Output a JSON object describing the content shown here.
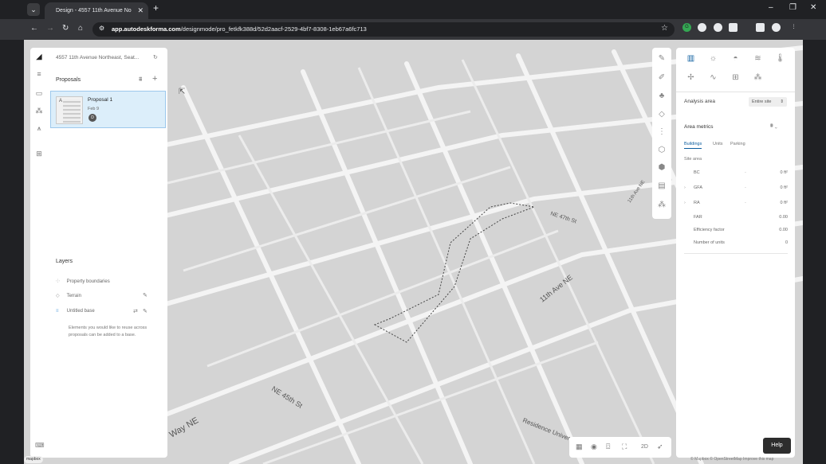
{
  "browser": {
    "tab_title": "Design - 4557 11th Avenue No",
    "tab_close": "✕",
    "new_tab": "+",
    "menu": "⌄",
    "controls": {
      "minimize": "–",
      "restore": "❐",
      "close": "✕"
    },
    "nav": {
      "back": "←",
      "forward": "→",
      "reload": "↻",
      "home": "⌂"
    },
    "url_host": "app.autodeskforma.com",
    "url_path": "/designmode/pro_fetkfk388d/52d2aacf-2529-4bf7-8308-1eb67a6fc713",
    "site_info_icon": "tune-icon",
    "bookmark_icon": "star-icon"
  },
  "left_panel": {
    "site_title": "4557 11th Avenue Northeast, Seat...",
    "proposals_label": "Proposals",
    "proposal": {
      "name": "Proposal 1",
      "date": "Feb 9",
      "avatar": "D",
      "thumb_letter": "A"
    },
    "layers_label": "Layers",
    "layers": [
      {
        "label": "Property boundaries",
        "icon": "boundary-icon"
      },
      {
        "label": "Terrain",
        "icon": "terrain-icon"
      },
      {
        "label": "Untitled base",
        "icon": "base-icon"
      }
    ],
    "base_note": "Elements you would like to reuse across proposals can be added to a base."
  },
  "right_panel": {
    "analysis_area_label": "Analysis area",
    "analysis_area_value": "Entire site",
    "area_metrics_label": "Area metrics",
    "tabs": [
      "Buildings",
      "Units",
      "Parking"
    ],
    "active_tab": "Buildings",
    "site_area_label": "Site area",
    "metrics": [
      {
        "label": "BC",
        "dash": "-",
        "value": "0 ft²",
        "expandable": false
      },
      {
        "label": "GFA",
        "dash": "-",
        "value": "0 ft²",
        "expandable": true
      },
      {
        "label": "RA",
        "dash": "-",
        "value": "0 ft²",
        "expandable": true
      },
      {
        "label": "FAR",
        "dash": "",
        "value": "0.00",
        "expandable": false
      },
      {
        "label": "Efficiency factor",
        "dash": "",
        "value": "0.00",
        "expandable": false
      },
      {
        "label": "Number of units",
        "dash": "",
        "value": "0",
        "expandable": false
      }
    ]
  },
  "map": {
    "street_labels": [
      "NE 45th St",
      "11th Ave NE",
      "NE 47th St",
      "11th Ave NE",
      "Way NE",
      "Residence University D"
    ],
    "attribution": "© Mapbox © OpenStreetMap Improve this map",
    "mapbox_logo": "mapbox"
  },
  "bottom_bar": {
    "mode_2d": "2D"
  },
  "help_label": "Help",
  "colors": {
    "accent": "#0a5c9e",
    "selection": "#dceefa",
    "map_block": "#d4d4d4",
    "map_road": "#f4f4f4"
  }
}
